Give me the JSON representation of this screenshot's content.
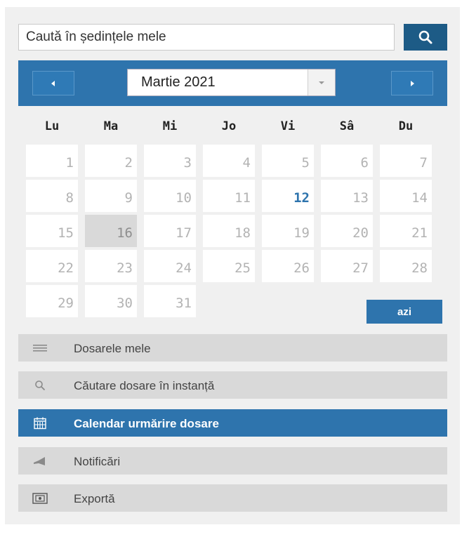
{
  "search": {
    "placeholder": "Caută în ședințele mele",
    "button_icon": "search-icon"
  },
  "calendar": {
    "month_label": "Martie 2021",
    "prev_icon": "chevron-left-icon",
    "next_icon": "chevron-right-icon",
    "dropdown_icon": "chevron-down-icon",
    "weekdays": [
      "Lu",
      "Ma",
      "Mi",
      "Jo",
      "Vi",
      "Sâ",
      "Du"
    ],
    "days": [
      "1",
      "2",
      "3",
      "4",
      "5",
      "6",
      "7",
      "8",
      "9",
      "10",
      "11",
      "12",
      "13",
      "14",
      "15",
      "16",
      "17",
      "18",
      "19",
      "20",
      "21",
      "22",
      "23",
      "24",
      "25",
      "26",
      "27",
      "28",
      "29",
      "30",
      "31"
    ],
    "today": "12",
    "selected": "16",
    "today_button": "azi"
  },
  "menu": {
    "items": [
      {
        "label": "Dosarele mele",
        "icon": "list-icon",
        "active": false
      },
      {
        "label": "Căutare dosare în instanță",
        "icon": "search-icon",
        "active": false
      },
      {
        "label": "Calendar urmărire dosare",
        "icon": "calendar-icon",
        "active": true
      },
      {
        "label": "Notificări",
        "icon": "horn-icon",
        "active": false
      },
      {
        "label": "Exportă",
        "icon": "export-icon",
        "active": false
      }
    ]
  },
  "colors": {
    "accent": "#2e74ad",
    "search_button": "#1d5b86",
    "panel": "#f0f0f0",
    "menu_item": "#d9d9d9"
  }
}
